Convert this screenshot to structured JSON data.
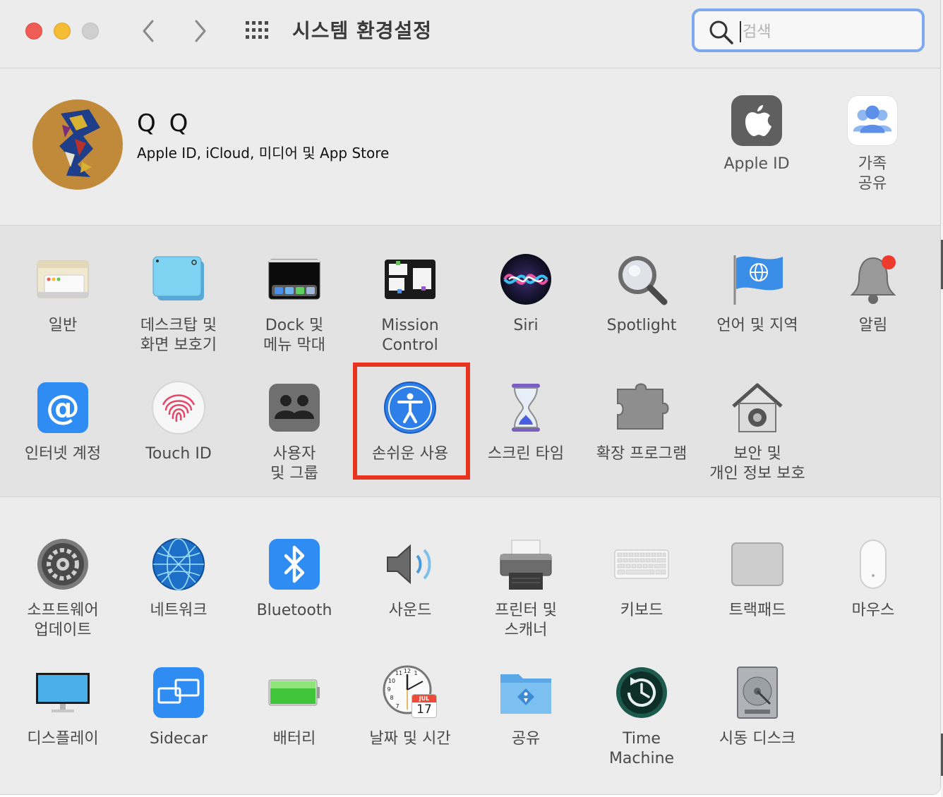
{
  "window": {
    "title": "시스템 환경설정"
  },
  "search": {
    "placeholder": "검색",
    "value": ""
  },
  "account": {
    "name": "Q Q",
    "subtitle": "Apple ID, iCloud, 미디어 및 App Store",
    "items": [
      {
        "label": "Apple ID",
        "icon": "apple-logo-icon"
      },
      {
        "label": "가족\n공유",
        "icon": "family-sharing-icon"
      }
    ]
  },
  "prefs_row1": [
    {
      "label": "일반",
      "icon": "general-icon"
    },
    {
      "label": "데스크탑 및\n화면 보호기",
      "icon": "desktop-screensaver-icon"
    },
    {
      "label": "Dock 및\n메뉴 막대",
      "icon": "dock-menubar-icon"
    },
    {
      "label": "Mission\nControl",
      "icon": "mission-control-icon"
    },
    {
      "label": "Siri",
      "icon": "siri-icon"
    },
    {
      "label": "Spotlight",
      "icon": "spotlight-icon"
    },
    {
      "label": "언어 및 지역",
      "icon": "language-region-icon"
    },
    {
      "label": "알림",
      "icon": "notifications-bell-icon"
    }
  ],
  "prefs_row2": [
    {
      "label": "인터넷 계정",
      "icon": "internet-accounts-icon"
    },
    {
      "label": "Touch ID",
      "icon": "fingerprint-icon"
    },
    {
      "label": "사용자\n및 그룹",
      "icon": "users-groups-icon"
    },
    {
      "label": "손쉬운 사용",
      "icon": "accessibility-icon",
      "highlighted": true
    },
    {
      "label": "스크린 타임",
      "icon": "hourglass-icon"
    },
    {
      "label": "확장 프로그램",
      "icon": "puzzle-piece-icon"
    },
    {
      "label": "보안 및\n개인 정보 보호",
      "icon": "security-house-icon"
    }
  ],
  "prefs_row3": [
    {
      "label": "소프트웨어\n업데이트",
      "icon": "software-update-gear-icon"
    },
    {
      "label": "네트워크",
      "icon": "network-globe-icon"
    },
    {
      "label": "Bluetooth",
      "icon": "bluetooth-icon"
    },
    {
      "label": "사운드",
      "icon": "speaker-icon"
    },
    {
      "label": "프린터 및\n스캐너",
      "icon": "printer-icon"
    },
    {
      "label": "키보드",
      "icon": "keyboard-icon"
    },
    {
      "label": "트랙패드",
      "icon": "trackpad-icon"
    },
    {
      "label": "마우스",
      "icon": "mouse-icon"
    }
  ],
  "prefs_row4": [
    {
      "label": "디스플레이",
      "icon": "display-icon"
    },
    {
      "label": "Sidecar",
      "icon": "sidecar-icon"
    },
    {
      "label": "배터리",
      "icon": "battery-icon"
    },
    {
      "label": "날짜 및 시간",
      "icon": "clock-calendar-icon",
      "calendar_month": "JUL",
      "calendar_day": "17"
    },
    {
      "label": "공유",
      "icon": "sharing-folder-icon"
    },
    {
      "label": "Time\nMachine",
      "icon": "time-machine-icon"
    },
    {
      "label": "시동 디스크",
      "icon": "startup-disk-icon"
    }
  ],
  "colors": {
    "highlight": "#e8331f",
    "search_focus": "#7fa8ef"
  }
}
